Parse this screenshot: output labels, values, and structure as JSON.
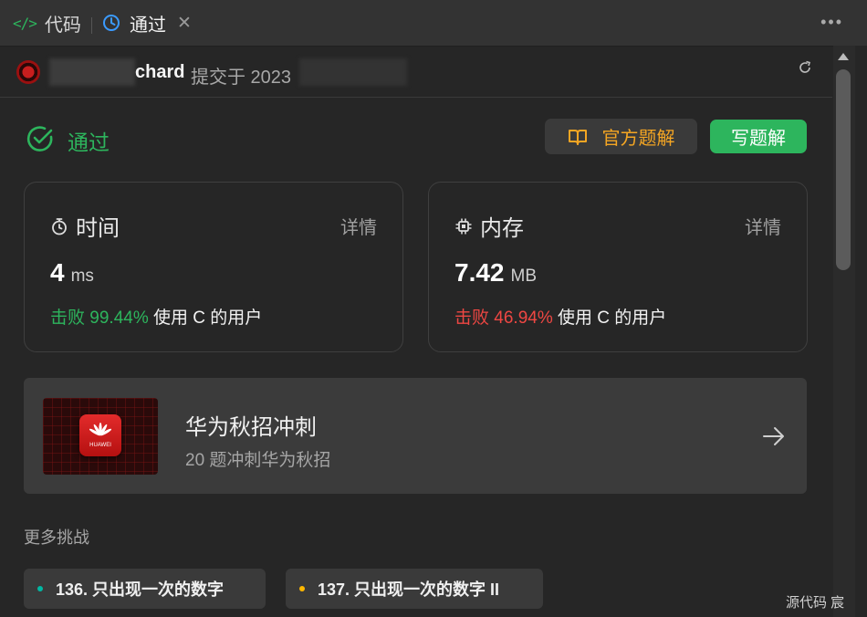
{
  "tabs": {
    "code_icon": "</>",
    "code_label": "代码",
    "pass_label": "通过",
    "close_glyph": "✕",
    "more_glyph": "•••"
  },
  "submission": {
    "username_visible": "chard",
    "meta": "提交于 2023"
  },
  "status": {
    "label": "通过",
    "official_solution_label": "官方题解",
    "write_solution_label": "写题解"
  },
  "time_card": {
    "title": "时间",
    "detail_label": "详情",
    "value": "4",
    "unit": "ms",
    "beat_label": "击败",
    "beat_value": "99.44%",
    "users_label": "使用 C 的用户"
  },
  "memory_card": {
    "title": "内存",
    "detail_label": "详情",
    "value": "7.42",
    "unit": "MB",
    "beat_label": "击败",
    "beat_value": "46.94%",
    "users_label": "使用 C 的用户"
  },
  "promo": {
    "title": "华为秋招冲刺",
    "subtitle": "20 题冲刺华为秋招",
    "logo_text": "HUAWEI"
  },
  "more_challenges": {
    "title": "更多挑战",
    "items": [
      {
        "label": "136. 只出现一次的数字",
        "difficulty_color": "#00b8a3"
      },
      {
        "label": "137. 只出现一次的数字 II",
        "difficulty_color": "#ffb800"
      }
    ]
  },
  "bottom": {
    "text": "源代码  宸"
  },
  "colors": {
    "accent_green": "#2db55d",
    "accent_orange": "#f5a623",
    "beat_red": "#ef4743"
  },
  "icons": [
    "code-icon",
    "clock-icon",
    "close-icon",
    "more-icon",
    "refresh-icon",
    "check-circle-icon",
    "book-icon",
    "stopwatch-icon",
    "chip-icon",
    "arrow-right-icon",
    "huawei-logo"
  ]
}
